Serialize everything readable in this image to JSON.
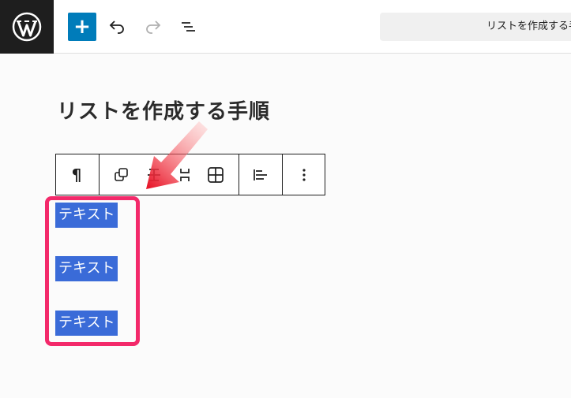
{
  "topbar": {
    "logo": "wordpress-logo",
    "add_label": "+",
    "undo_icon": "undo-icon",
    "redo_icon": "redo-icon",
    "outline_icon": "list-view-icon",
    "document_title": "リストを作成する手順"
  },
  "editor": {
    "heading": "リストを作成する手順",
    "block_toolbar": {
      "paragraph_icon": "¶",
      "tools": [
        "duplicate-icon",
        "move-icon",
        "unlink-icon",
        "table-icon",
        "align-left-icon",
        "more-options-icon"
      ]
    },
    "items": [
      "テキスト",
      "テキスト",
      "テキスト"
    ]
  },
  "colors": {
    "accent": "#007cba",
    "selection": "#3a6bd8",
    "annotation": "#f3296a",
    "arrow": "#e8192c"
  }
}
